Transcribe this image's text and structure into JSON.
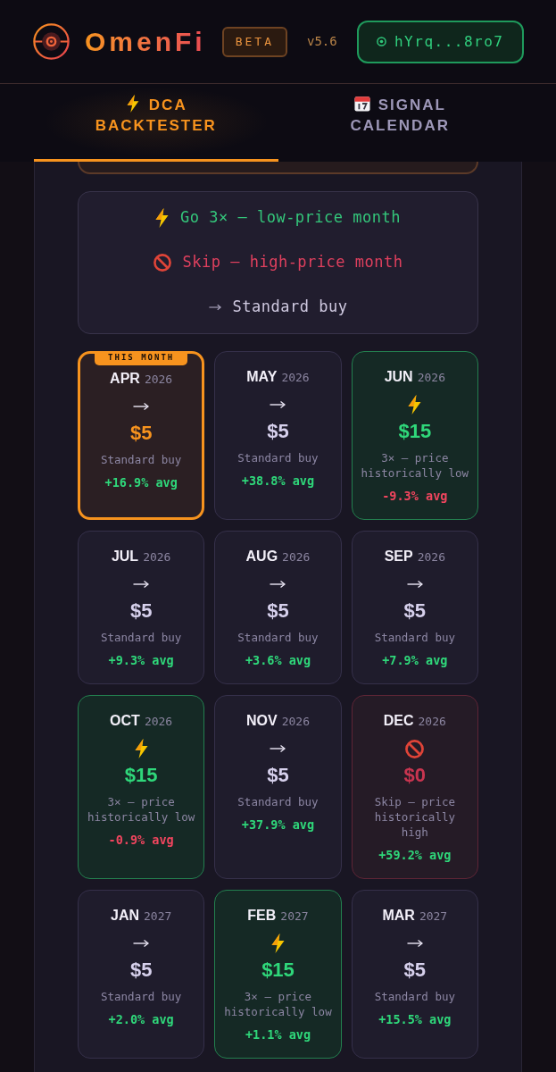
{
  "header": {
    "brand": "OmenFi",
    "badge": "BETA",
    "version": "v5.6",
    "wallet": "hYrq...8ro7"
  },
  "tabs": [
    {
      "label": "DCA BACKTESTER",
      "selected": true
    },
    {
      "label": "SIGNAL CALENDAR",
      "selected": false
    }
  ],
  "legend": [
    {
      "kind": "boost",
      "label": "Go 3× — low-price month"
    },
    {
      "kind": "skip",
      "label": "Skip — high-price month"
    },
    {
      "kind": "standard",
      "label": "Standard buy"
    }
  ],
  "months": [
    {
      "month": "APR",
      "year": "2026",
      "kind": "standard",
      "amount": "$5",
      "note": "Standard buy",
      "avg": "+16.9% avg",
      "avg_positive": true,
      "current": true,
      "badge": "THIS MONTH"
    },
    {
      "month": "MAY",
      "year": "2026",
      "kind": "standard",
      "amount": "$5",
      "note": "Standard buy",
      "avg": "+38.8% avg",
      "avg_positive": true,
      "current": false
    },
    {
      "month": "JUN",
      "year": "2026",
      "kind": "boost",
      "amount": "$15",
      "note": "3× — price historically low",
      "avg": "-9.3% avg",
      "avg_positive": false,
      "current": false
    },
    {
      "month": "JUL",
      "year": "2026",
      "kind": "standard",
      "amount": "$5",
      "note": "Standard buy",
      "avg": "+9.3% avg",
      "avg_positive": true,
      "current": false
    },
    {
      "month": "AUG",
      "year": "2026",
      "kind": "standard",
      "amount": "$5",
      "note": "Standard buy",
      "avg": "+3.6% avg",
      "avg_positive": true,
      "current": false
    },
    {
      "month": "SEP",
      "year": "2026",
      "kind": "standard",
      "amount": "$5",
      "note": "Standard buy",
      "avg": "+7.9% avg",
      "avg_positive": true,
      "current": false
    },
    {
      "month": "OCT",
      "year": "2026",
      "kind": "boost",
      "amount": "$15",
      "note": "3× — price historically low",
      "avg": "-0.9% avg",
      "avg_positive": false,
      "current": false
    },
    {
      "month": "NOV",
      "year": "2026",
      "kind": "standard",
      "amount": "$5",
      "note": "Standard buy",
      "avg": "+37.9% avg",
      "avg_positive": true,
      "current": false
    },
    {
      "month": "DEC",
      "year": "2026",
      "kind": "skip",
      "amount": "$0",
      "note": "Skip — price historically high",
      "avg": "+59.2% avg",
      "avg_positive": true,
      "current": false
    },
    {
      "month": "JAN",
      "year": "2027",
      "kind": "standard",
      "amount": "$5",
      "note": "Standard buy",
      "avg": "+2.0% avg",
      "avg_positive": true,
      "current": false
    },
    {
      "month": "FEB",
      "year": "2027",
      "kind": "boost",
      "amount": "$15",
      "note": "3× — price historically low",
      "avg": "+1.1% avg",
      "avg_positive": true,
      "current": false
    },
    {
      "month": "MAR",
      "year": "2027",
      "kind": "standard",
      "amount": "$5",
      "note": "Standard buy",
      "avg": "+15.5% avg",
      "avg_positive": true,
      "current": false
    }
  ]
}
